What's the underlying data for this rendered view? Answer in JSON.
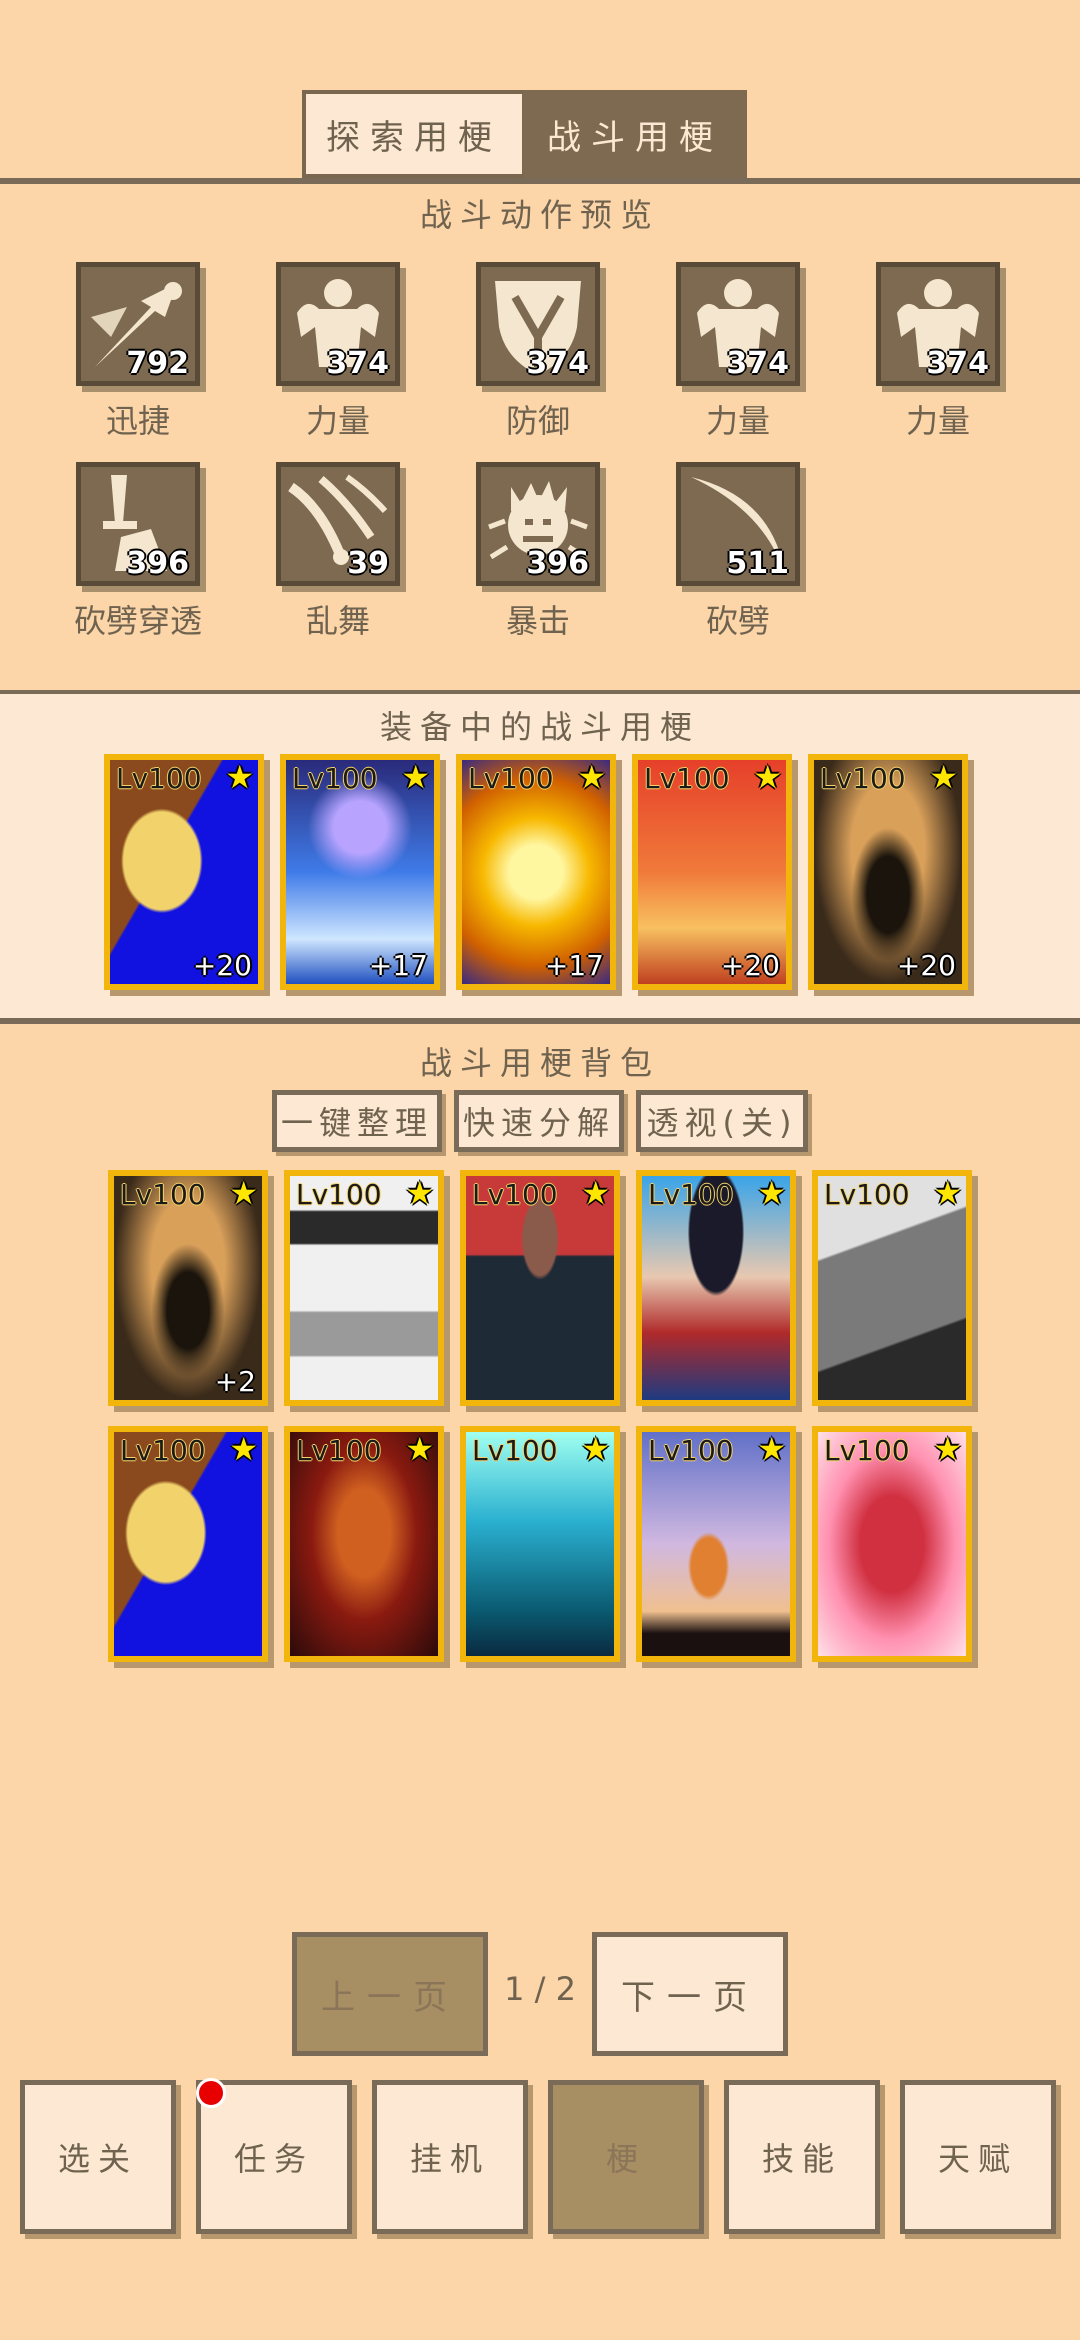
{
  "top_tabs": {
    "explore": "探索用梗",
    "battle": "战斗用梗"
  },
  "preview": {
    "title": "战斗动作预览",
    "actions": [
      {
        "label": "迅捷",
        "value": "792",
        "icon": "sprint-icon"
      },
      {
        "label": "力量",
        "value": "374",
        "icon": "strength-icon"
      },
      {
        "label": "防御",
        "value": "374",
        "icon": "shield-icon"
      },
      {
        "label": "力量",
        "value": "374",
        "icon": "strength-icon"
      },
      {
        "label": "力量",
        "value": "374",
        "icon": "strength-icon"
      },
      {
        "label": "砍劈穿透",
        "value": "396",
        "icon": "sword-pierce-icon"
      },
      {
        "label": "乱舞",
        "value": "39",
        "icon": "flurry-icon"
      },
      {
        "label": "暴击",
        "value": "396",
        "icon": "rage-icon"
      },
      {
        "label": "砍劈",
        "value": "511",
        "icon": "slash-icon"
      }
    ]
  },
  "equipped": {
    "title": "装备中的战斗用梗",
    "cards": [
      {
        "level": "Lv100",
        "plus": "+20",
        "art": "blue-yellow-beast"
      },
      {
        "level": "Lv100",
        "plus": "+17",
        "art": "blue-storm"
      },
      {
        "level": "Lv100",
        "plus": "+17",
        "art": "golden-explosion"
      },
      {
        "level": "Lv100",
        "plus": "+20",
        "art": "red-sunset"
      },
      {
        "level": "Lv100",
        "plus": "+20",
        "art": "bearded-warrior"
      }
    ]
  },
  "backpack": {
    "title": "战斗用梗背包",
    "buttons": {
      "organize": "一键整理",
      "decompose": "快速分解",
      "xray": "透视(关)"
    },
    "cards": [
      {
        "level": "Lv100",
        "plus": "+2",
        "art": "bearded-warrior"
      },
      {
        "level": "Lv100",
        "plus": "",
        "art": "bw-meme"
      },
      {
        "level": "Lv100",
        "plus": "",
        "art": "dark-shirt-man"
      },
      {
        "level": "Lv100",
        "plus": "",
        "art": "saiyan-girl"
      },
      {
        "level": "Lv100",
        "plus": "",
        "art": "grey-spaceship"
      },
      {
        "level": "Lv100",
        "plus": "",
        "art": "blue-yellow-beast"
      },
      {
        "level": "Lv100",
        "plus": "",
        "art": "red-demon"
      },
      {
        "level": "Lv100",
        "plus": "",
        "art": "cyan-beam"
      },
      {
        "level": "Lv100",
        "plus": "",
        "art": "flying-fighter"
      },
      {
        "level": "Lv100",
        "plus": "",
        "art": "pink-mech"
      }
    ]
  },
  "pager": {
    "prev": "上一页",
    "indicator": "1 / 2",
    "next": "下一页"
  },
  "nav": [
    {
      "label": "选关",
      "active": false
    },
    {
      "label": "任务",
      "active": false,
      "badge": true
    },
    {
      "label": "挂机",
      "active": false
    },
    {
      "label": "梗",
      "active": true
    },
    {
      "label": "技能",
      "active": false
    },
    {
      "label": "天赋",
      "active": false
    }
  ],
  "colors": {
    "background": "#fcd5a8",
    "panel_light": "#fde9d3",
    "brown": "#7d6a50",
    "card_border": "#f2b50c",
    "badge_red": "#e80000"
  }
}
